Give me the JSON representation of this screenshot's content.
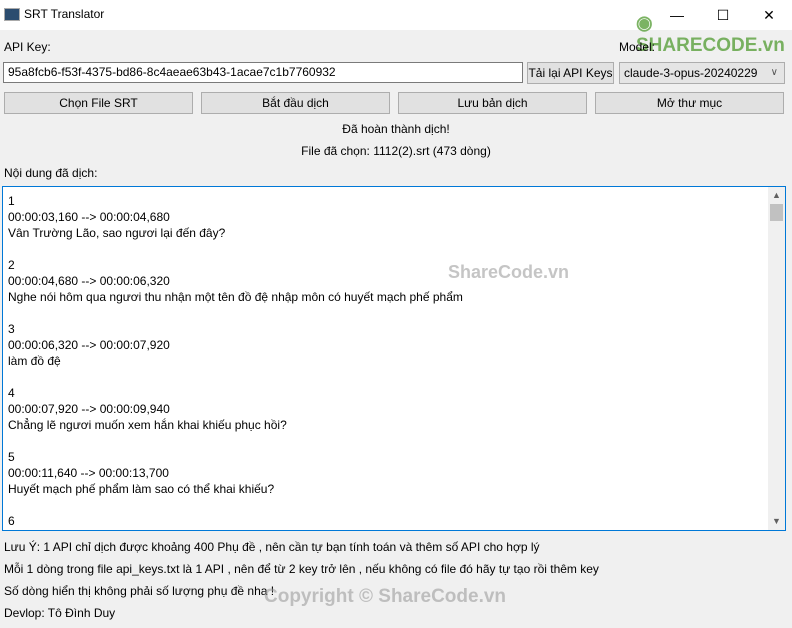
{
  "window": {
    "title": "SRT Translator",
    "minimize": "—",
    "maximize": "☐",
    "close": "✕"
  },
  "api": {
    "label": "API Key:",
    "value": "95a8fcb6-f53f-4375-bd86-8c4aeae63b43-1acae7c1b7760932",
    "reload_label": "Tải lại API Keys"
  },
  "model": {
    "label": "Model:",
    "selected": "claude-3-opus-20240229"
  },
  "buttons": {
    "choose": "Chọn File SRT",
    "start": "Bắt đầu dịch",
    "save": "Lưu bản dịch",
    "open": "Mở thư mục"
  },
  "status": {
    "message": "Đã hoàn thành dịch!",
    "file": "File đã chọn: 1112(2).srt (473 dòng)"
  },
  "content": {
    "label": "Nội dung đã dịch:",
    "lines": [
      "1",
      "00:00:03,160 --> 00:00:04,680",
      "Vân Trường Lão, sao ngươi lại đến đây?",
      "",
      "2",
      "00:00:04,680 --> 00:00:06,320",
      "Nghe nói hôm qua ngươi thu nhận một tên đồ đệ nhập môn có huyết mạch phế phẩm",
      "",
      "3",
      "00:00:06,320 --> 00:00:07,920",
      "làm đồ đệ",
      "",
      "4",
      "00:00:07,920 --> 00:00:09,940",
      "Chẳng lẽ ngươi muốn xem hắn khai khiếu phục hồi?",
      "",
      "5",
      "00:00:11,640 --> 00:00:13,700",
      "Huyết mạch phế phẩm làm sao có thể khai khiếu?",
      "",
      "6"
    ]
  },
  "notes": [
    "Lưu Ý: 1 API chỉ dịch được khoảng 400 Phụ đề , nên cần tự bạn tính toán và thêm số API cho hợp lý",
    "Mỗi 1 dòng trong file api_keys.txt là 1 API , nên để từ 2 key trở lên , nếu không có file đó hãy tự tạo rồi thêm key",
    "Số dòng hiển thị không phải số lượng phụ đề nha !",
    "Devlop: Tô Đình Duy"
  ],
  "watermarks": {
    "logo": "SHARECODE.vn",
    "center": "ShareCode.vn",
    "footer": "Copyright © ShareCode.vn"
  },
  "colors": {
    "focus_border": "#0078d7",
    "logo_green": "#6ab344"
  }
}
